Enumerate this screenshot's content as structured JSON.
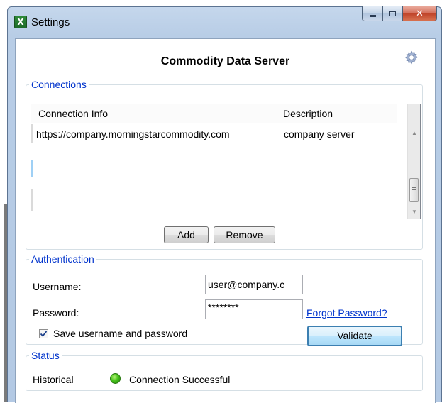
{
  "window": {
    "title": "Settings",
    "app_icon_glyph": "X",
    "controls": {
      "minimize": "minimize-icon",
      "maximize": "maximize-icon",
      "close": "close-icon"
    }
  },
  "header": {
    "title": "Commodity Data Server",
    "settings_icon": "gear-icon"
  },
  "connections": {
    "legend": "Connections",
    "columns": [
      "Connection Info",
      "Description"
    ],
    "rows": [
      {
        "connection_info": "https://company.morningstarcommodity.com",
        "description": "company server"
      }
    ],
    "add_label": "Add",
    "remove_label": "Remove"
  },
  "authentication": {
    "legend": "Authentication",
    "username_label": "Username:",
    "username_value": "user@company.c",
    "password_label": "Password:",
    "password_value": "********",
    "forgot_password_label": "Forgot Password?",
    "save_credentials_label": "Save username and password",
    "save_credentials_checked": true,
    "validate_label": "Validate"
  },
  "status": {
    "legend": "Status",
    "source_label": "Historical",
    "message": "Connection Successful",
    "indicator_color": "#46c21a"
  },
  "colors": {
    "legend_text": "#0033cc",
    "link": "#0033cc",
    "window_frame": "#b8cde6",
    "close_button": "#c0442a"
  }
}
